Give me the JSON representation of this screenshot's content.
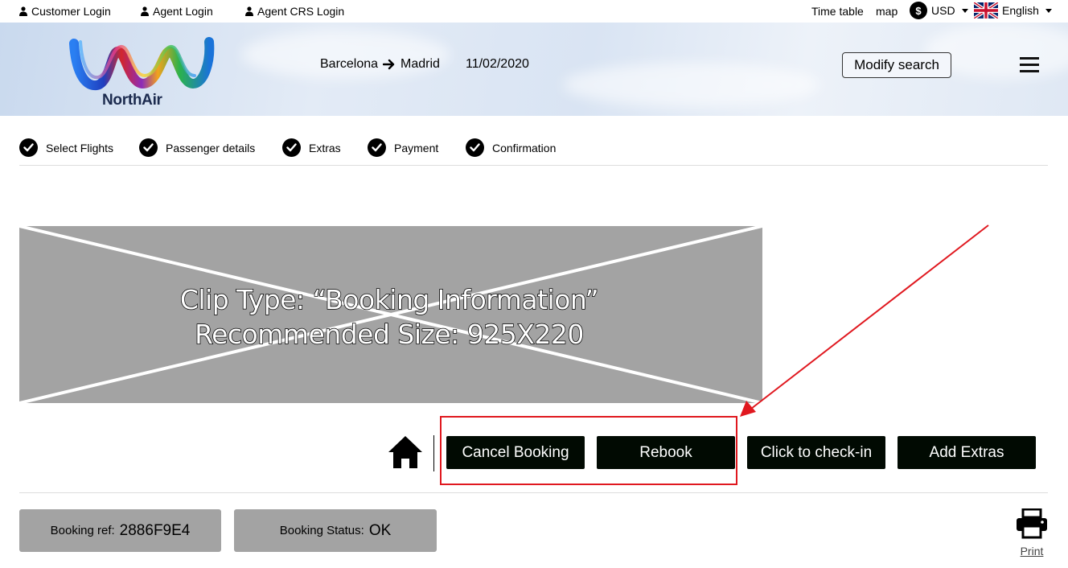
{
  "topbar": {
    "customer_login": "Customer Login",
    "agent_login": "Agent Login",
    "agent_crs_login": "Agent CRS Login",
    "time_table": "Time table",
    "map": "map",
    "currency_symbol": "$",
    "currency": "USD",
    "language": "English"
  },
  "header": {
    "brand": "NorthAir",
    "origin": "Barcelona",
    "destination": "Madrid",
    "date": "11/02/2020",
    "modify_search": "Modify search"
  },
  "steps": [
    {
      "label": "Select Flights"
    },
    {
      "label": "Passenger details"
    },
    {
      "label": "Extras"
    },
    {
      "label": "Payment"
    },
    {
      "label": "Confirmation"
    }
  ],
  "clip": {
    "line1": "Clip Type: “Booking Information”",
    "line2": "Recommended Size: 925X220"
  },
  "actions": {
    "cancel_booking": "Cancel Booking",
    "rebook": "Rebook",
    "check_in": "Click to check-in",
    "add_extras": "Add Extras"
  },
  "booking": {
    "ref_label": "Booking ref:",
    "ref_value": "2886F9E4",
    "status_label": "Booking Status:",
    "status_value": "OK"
  },
  "print_label": "Print",
  "colors": {
    "button_bg": "#010a02",
    "placeholder_bg": "#a3a3a3",
    "annotation_red": "#e0181f"
  }
}
